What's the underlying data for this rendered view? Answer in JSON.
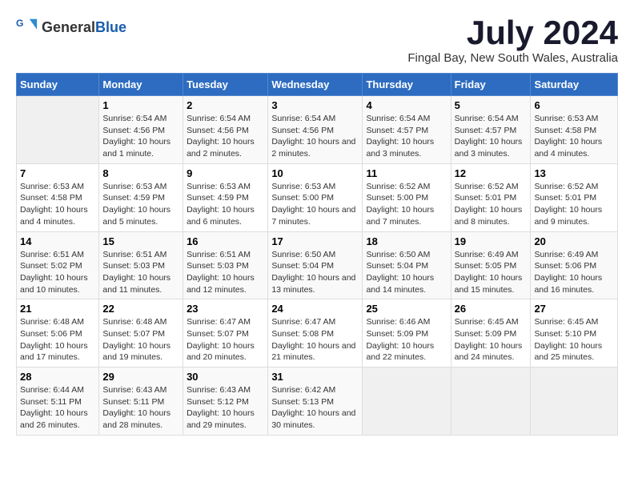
{
  "header": {
    "logo_general": "General",
    "logo_blue": "Blue",
    "title": "July 2024",
    "location": "Fingal Bay, New South Wales, Australia"
  },
  "days_of_week": [
    "Sunday",
    "Monday",
    "Tuesday",
    "Wednesday",
    "Thursday",
    "Friday",
    "Saturday"
  ],
  "weeks": [
    [
      {
        "day": "",
        "sunrise": "",
        "sunset": "",
        "daylight": ""
      },
      {
        "day": "1",
        "sunrise": "6:54 AM",
        "sunset": "4:56 PM",
        "daylight": "10 hours and 1 minute."
      },
      {
        "day": "2",
        "sunrise": "6:54 AM",
        "sunset": "4:56 PM",
        "daylight": "10 hours and 2 minutes."
      },
      {
        "day": "3",
        "sunrise": "6:54 AM",
        "sunset": "4:56 PM",
        "daylight": "10 hours and 2 minutes."
      },
      {
        "day": "4",
        "sunrise": "6:54 AM",
        "sunset": "4:57 PM",
        "daylight": "10 hours and 3 minutes."
      },
      {
        "day": "5",
        "sunrise": "6:54 AM",
        "sunset": "4:57 PM",
        "daylight": "10 hours and 3 minutes."
      },
      {
        "day": "6",
        "sunrise": "6:53 AM",
        "sunset": "4:58 PM",
        "daylight": "10 hours and 4 minutes."
      }
    ],
    [
      {
        "day": "7",
        "sunrise": "6:53 AM",
        "sunset": "4:58 PM",
        "daylight": "10 hours and 4 minutes."
      },
      {
        "day": "8",
        "sunrise": "6:53 AM",
        "sunset": "4:59 PM",
        "daylight": "10 hours and 5 minutes."
      },
      {
        "day": "9",
        "sunrise": "6:53 AM",
        "sunset": "4:59 PM",
        "daylight": "10 hours and 6 minutes."
      },
      {
        "day": "10",
        "sunrise": "6:53 AM",
        "sunset": "5:00 PM",
        "daylight": "10 hours and 7 minutes."
      },
      {
        "day": "11",
        "sunrise": "6:52 AM",
        "sunset": "5:00 PM",
        "daylight": "10 hours and 7 minutes."
      },
      {
        "day": "12",
        "sunrise": "6:52 AM",
        "sunset": "5:01 PM",
        "daylight": "10 hours and 8 minutes."
      },
      {
        "day": "13",
        "sunrise": "6:52 AM",
        "sunset": "5:01 PM",
        "daylight": "10 hours and 9 minutes."
      }
    ],
    [
      {
        "day": "14",
        "sunrise": "6:51 AM",
        "sunset": "5:02 PM",
        "daylight": "10 hours and 10 minutes."
      },
      {
        "day": "15",
        "sunrise": "6:51 AM",
        "sunset": "5:03 PM",
        "daylight": "10 hours and 11 minutes."
      },
      {
        "day": "16",
        "sunrise": "6:51 AM",
        "sunset": "5:03 PM",
        "daylight": "10 hours and 12 minutes."
      },
      {
        "day": "17",
        "sunrise": "6:50 AM",
        "sunset": "5:04 PM",
        "daylight": "10 hours and 13 minutes."
      },
      {
        "day": "18",
        "sunrise": "6:50 AM",
        "sunset": "5:04 PM",
        "daylight": "10 hours and 14 minutes."
      },
      {
        "day": "19",
        "sunrise": "6:49 AM",
        "sunset": "5:05 PM",
        "daylight": "10 hours and 15 minutes."
      },
      {
        "day": "20",
        "sunrise": "6:49 AM",
        "sunset": "5:06 PM",
        "daylight": "10 hours and 16 minutes."
      }
    ],
    [
      {
        "day": "21",
        "sunrise": "6:48 AM",
        "sunset": "5:06 PM",
        "daylight": "10 hours and 17 minutes."
      },
      {
        "day": "22",
        "sunrise": "6:48 AM",
        "sunset": "5:07 PM",
        "daylight": "10 hours and 19 minutes."
      },
      {
        "day": "23",
        "sunrise": "6:47 AM",
        "sunset": "5:07 PM",
        "daylight": "10 hours and 20 minutes."
      },
      {
        "day": "24",
        "sunrise": "6:47 AM",
        "sunset": "5:08 PM",
        "daylight": "10 hours and 21 minutes."
      },
      {
        "day": "25",
        "sunrise": "6:46 AM",
        "sunset": "5:09 PM",
        "daylight": "10 hours and 22 minutes."
      },
      {
        "day": "26",
        "sunrise": "6:45 AM",
        "sunset": "5:09 PM",
        "daylight": "10 hours and 24 minutes."
      },
      {
        "day": "27",
        "sunrise": "6:45 AM",
        "sunset": "5:10 PM",
        "daylight": "10 hours and 25 minutes."
      }
    ],
    [
      {
        "day": "28",
        "sunrise": "6:44 AM",
        "sunset": "5:11 PM",
        "daylight": "10 hours and 26 minutes."
      },
      {
        "day": "29",
        "sunrise": "6:43 AM",
        "sunset": "5:11 PM",
        "daylight": "10 hours and 28 minutes."
      },
      {
        "day": "30",
        "sunrise": "6:43 AM",
        "sunset": "5:12 PM",
        "daylight": "10 hours and 29 minutes."
      },
      {
        "day": "31",
        "sunrise": "6:42 AM",
        "sunset": "5:13 PM",
        "daylight": "10 hours and 30 minutes."
      },
      {
        "day": "",
        "sunrise": "",
        "sunset": "",
        "daylight": ""
      },
      {
        "day": "",
        "sunrise": "",
        "sunset": "",
        "daylight": ""
      },
      {
        "day": "",
        "sunrise": "",
        "sunset": "",
        "daylight": ""
      }
    ]
  ],
  "labels": {
    "sunrise_prefix": "Sunrise: ",
    "sunset_prefix": "Sunset: ",
    "daylight_prefix": "Daylight: "
  }
}
